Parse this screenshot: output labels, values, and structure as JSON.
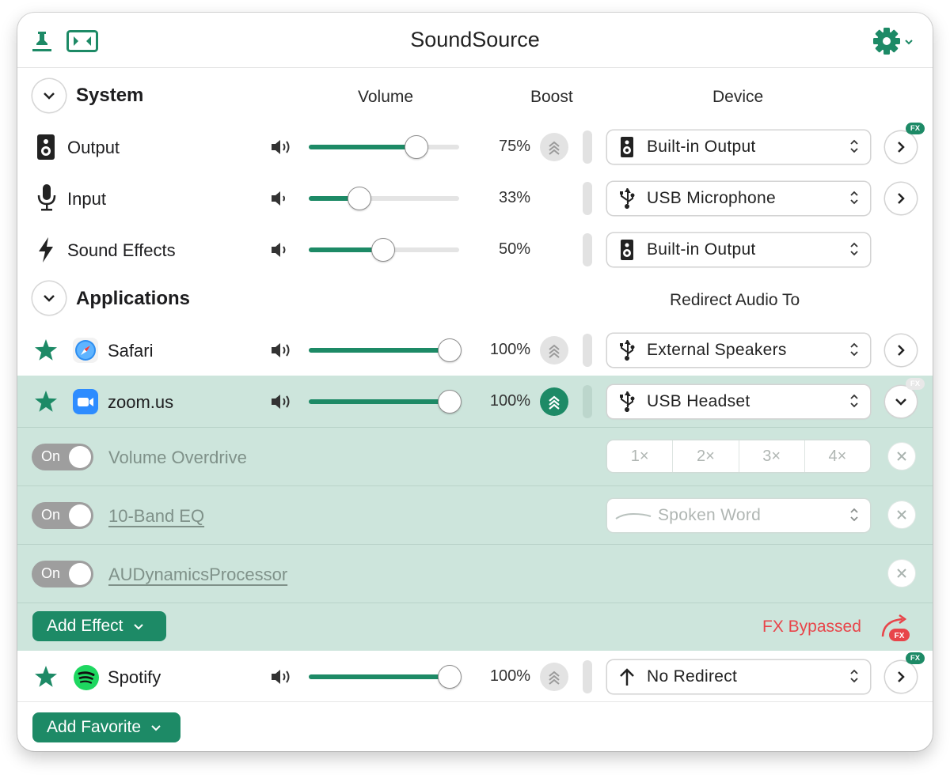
{
  "window": {
    "title": "SoundSource"
  },
  "toolbar": {
    "pin_icon": "pin-icon",
    "fit_icon": "resize-icon",
    "settings_icon": "gear-icon"
  },
  "system": {
    "heading": "System",
    "col_volume": "Volume",
    "col_boost": "Boost",
    "col_device": "Device",
    "rows": [
      {
        "name": "Output",
        "icon": "speaker-icon",
        "volume": 0.75,
        "volume_label": "75%",
        "device": "Built-in Output",
        "device_icon": "speaker-icon",
        "fx": true
      },
      {
        "name": "Input",
        "icon": "microphone-icon",
        "volume": 0.33,
        "volume_label": "33%",
        "device": "USB Microphone",
        "device_icon": "usb-icon"
      },
      {
        "name": "Sound Effects",
        "icon": "bolt-icon",
        "volume": 0.5,
        "volume_label": "50%",
        "device": "Built-in Output",
        "device_icon": "speaker-icon"
      }
    ]
  },
  "applications": {
    "heading": "Applications",
    "col_redirect": "Redirect Audio To",
    "rows": [
      {
        "name": "Safari",
        "volume": 1.0,
        "volume_label": "100%",
        "device": "External Speakers",
        "device_icon": "usb-icon",
        "boost": false
      },
      {
        "name": "zoom.us",
        "volume": 1.0,
        "volume_label": "100%",
        "device": "USB Headset",
        "device_icon": "usb-icon",
        "boost": true
      },
      {
        "name": "Spotify",
        "volume": 1.0,
        "volume_label": "100%",
        "device": "No Redirect",
        "device_icon": "arrow-up-icon",
        "boost": false
      }
    ]
  },
  "effects": {
    "items": [
      {
        "toggle": "On",
        "name": "Volume Overdrive"
      },
      {
        "toggle": "On",
        "name": "10-Band EQ"
      },
      {
        "toggle": "On",
        "name": "AUDynamicsProcessor"
      }
    ],
    "multipliers": [
      "1×",
      "2×",
      "3×",
      "4×"
    ],
    "eq_preset": "Spoken Word",
    "add_effect": "Add Effect",
    "bypassed": "FX Bypassed",
    "badge": "FX"
  },
  "footer": {
    "add_favorite": "Add Favorite"
  },
  "colors": {
    "accent": "#1d8a66",
    "fx_panel": "#cde5dc",
    "bypass_red": "#e8454a"
  }
}
